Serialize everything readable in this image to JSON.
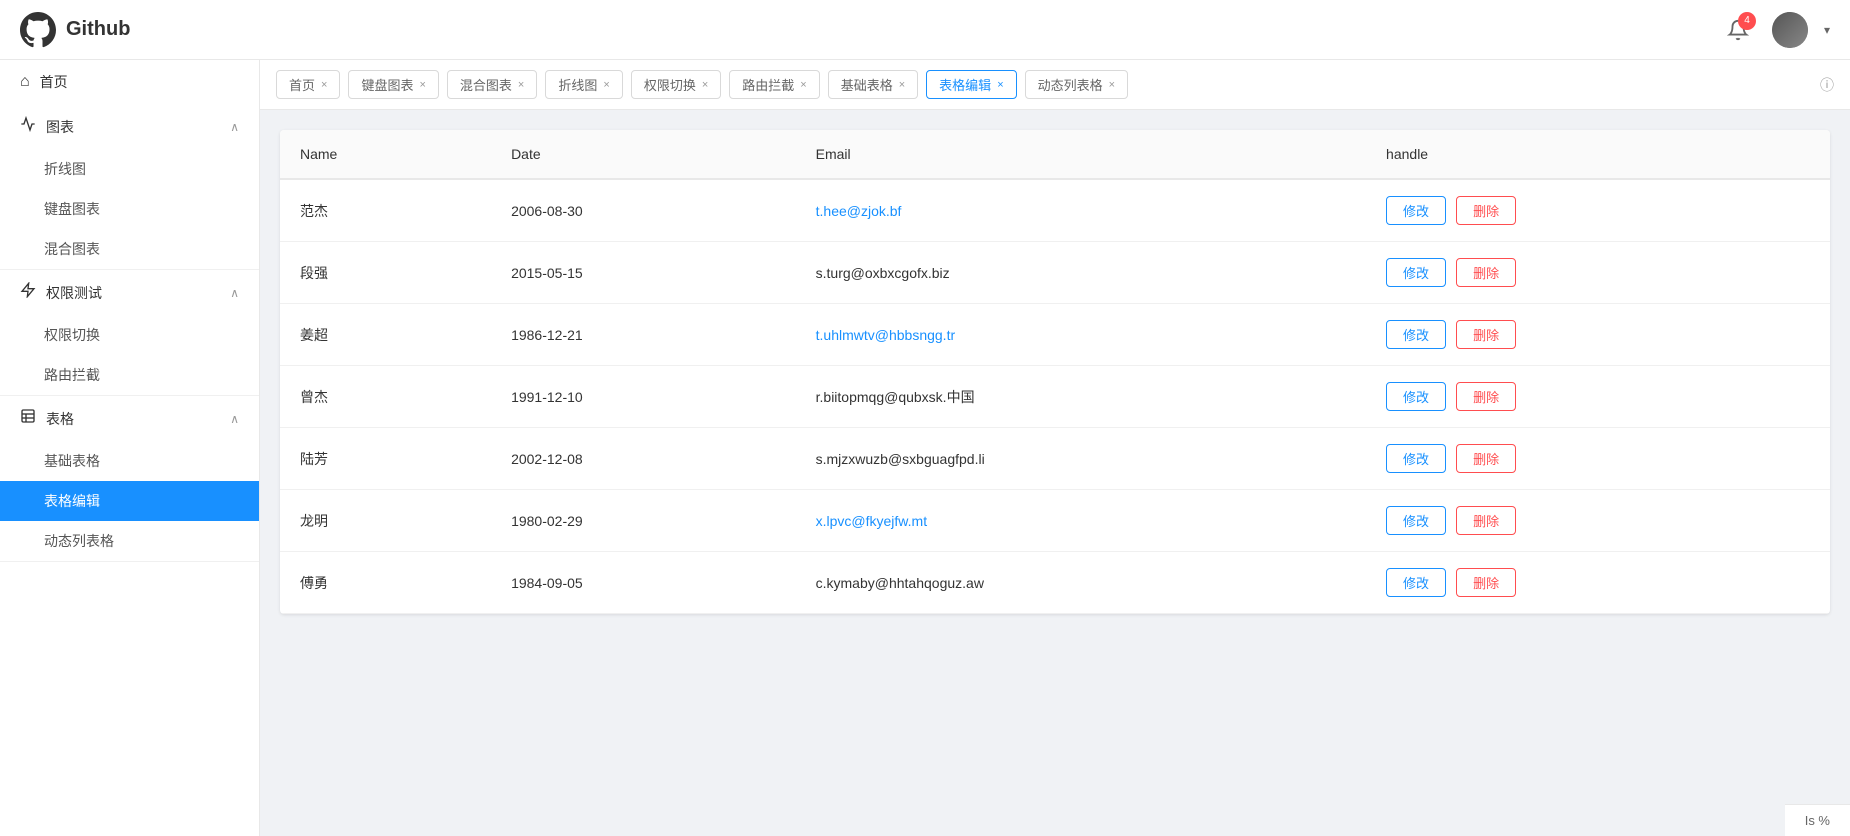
{
  "header": {
    "logo_alt": "Github",
    "title": "Github",
    "notification_count": "4",
    "dropdown_arrow": "▾"
  },
  "sidebar": {
    "menu_icon": "☰",
    "items": [
      {
        "id": "home",
        "icon": "⌂",
        "label": "首页",
        "type": "item"
      },
      {
        "id": "charts",
        "icon": "📈",
        "label": "图表",
        "type": "group",
        "expanded": true,
        "children": [
          {
            "id": "line-chart",
            "label": "折线图"
          },
          {
            "id": "keyboard-chart",
            "label": "键盘图表"
          },
          {
            "id": "mixed-chart",
            "label": "混合图表"
          }
        ]
      },
      {
        "id": "permissions",
        "icon": "🚀",
        "label": "权限测试",
        "type": "group",
        "expanded": true,
        "children": [
          {
            "id": "permission-switch",
            "label": "权限切换"
          },
          {
            "id": "route-guard",
            "label": "路由拦截"
          }
        ]
      },
      {
        "id": "table",
        "icon": "📄",
        "label": "表格",
        "type": "group",
        "expanded": true,
        "children": [
          {
            "id": "basic-table",
            "label": "基础表格"
          },
          {
            "id": "table-edit",
            "label": "表格编辑",
            "active": true
          },
          {
            "id": "dynamic-table",
            "label": "动态列表格"
          }
        ]
      }
    ]
  },
  "tabs": [
    {
      "id": "home",
      "label": "首页",
      "closable": true
    },
    {
      "id": "keyboard-chart",
      "label": "键盘图表",
      "closable": true
    },
    {
      "id": "mixed-chart",
      "label": "混合图表",
      "closable": true
    },
    {
      "id": "line-chart",
      "label": "折线图",
      "closable": true
    },
    {
      "id": "permission-switch",
      "label": "权限切换",
      "closable": true
    },
    {
      "id": "route-guard",
      "label": "路由拦截",
      "closable": true
    },
    {
      "id": "basic-table",
      "label": "基础表格",
      "closable": true
    },
    {
      "id": "table-edit",
      "label": "表格编辑",
      "closable": true,
      "active": true
    },
    {
      "id": "dynamic-table",
      "label": "动态列表格",
      "closable": true
    }
  ],
  "table": {
    "columns": [
      {
        "key": "name",
        "label": "Name"
      },
      {
        "key": "date",
        "label": "Date"
      },
      {
        "key": "email",
        "label": "Email"
      },
      {
        "key": "handle",
        "label": "handle"
      }
    ],
    "rows": [
      {
        "name": "范杰",
        "date": "2006-08-30",
        "email": "t.hee@zjok.bf",
        "email_color": "#1890ff"
      },
      {
        "name": "段强",
        "date": "2015-05-15",
        "email": "s.turg@oxbxcgofx.biz",
        "email_color": "#333"
      },
      {
        "name": "姜超",
        "date": "1986-12-21",
        "email": "t.uhlmwtv@hbbsngg.tr",
        "email_color": "#1890ff"
      },
      {
        "name": "曾杰",
        "date": "1991-12-10",
        "email": "r.biitopmqg@qubxsk.中国",
        "email_color": "#333"
      },
      {
        "name": "陆芳",
        "date": "2002-12-08",
        "email": "s.mjzxwuzb@sxbguagfpd.li",
        "email_color": "#333"
      },
      {
        "name": "龙明",
        "date": "1980-02-29",
        "email": "x.lpvc@fkyejfw.mt",
        "email_color": "#1890ff"
      },
      {
        "name": "傅勇",
        "date": "1984-09-05",
        "email": "c.kymaby@hhtahqoguz.aw",
        "email_color": "#333"
      }
    ],
    "btn_edit": "修改",
    "btn_delete": "删除"
  },
  "bottom_hint": "Is %"
}
